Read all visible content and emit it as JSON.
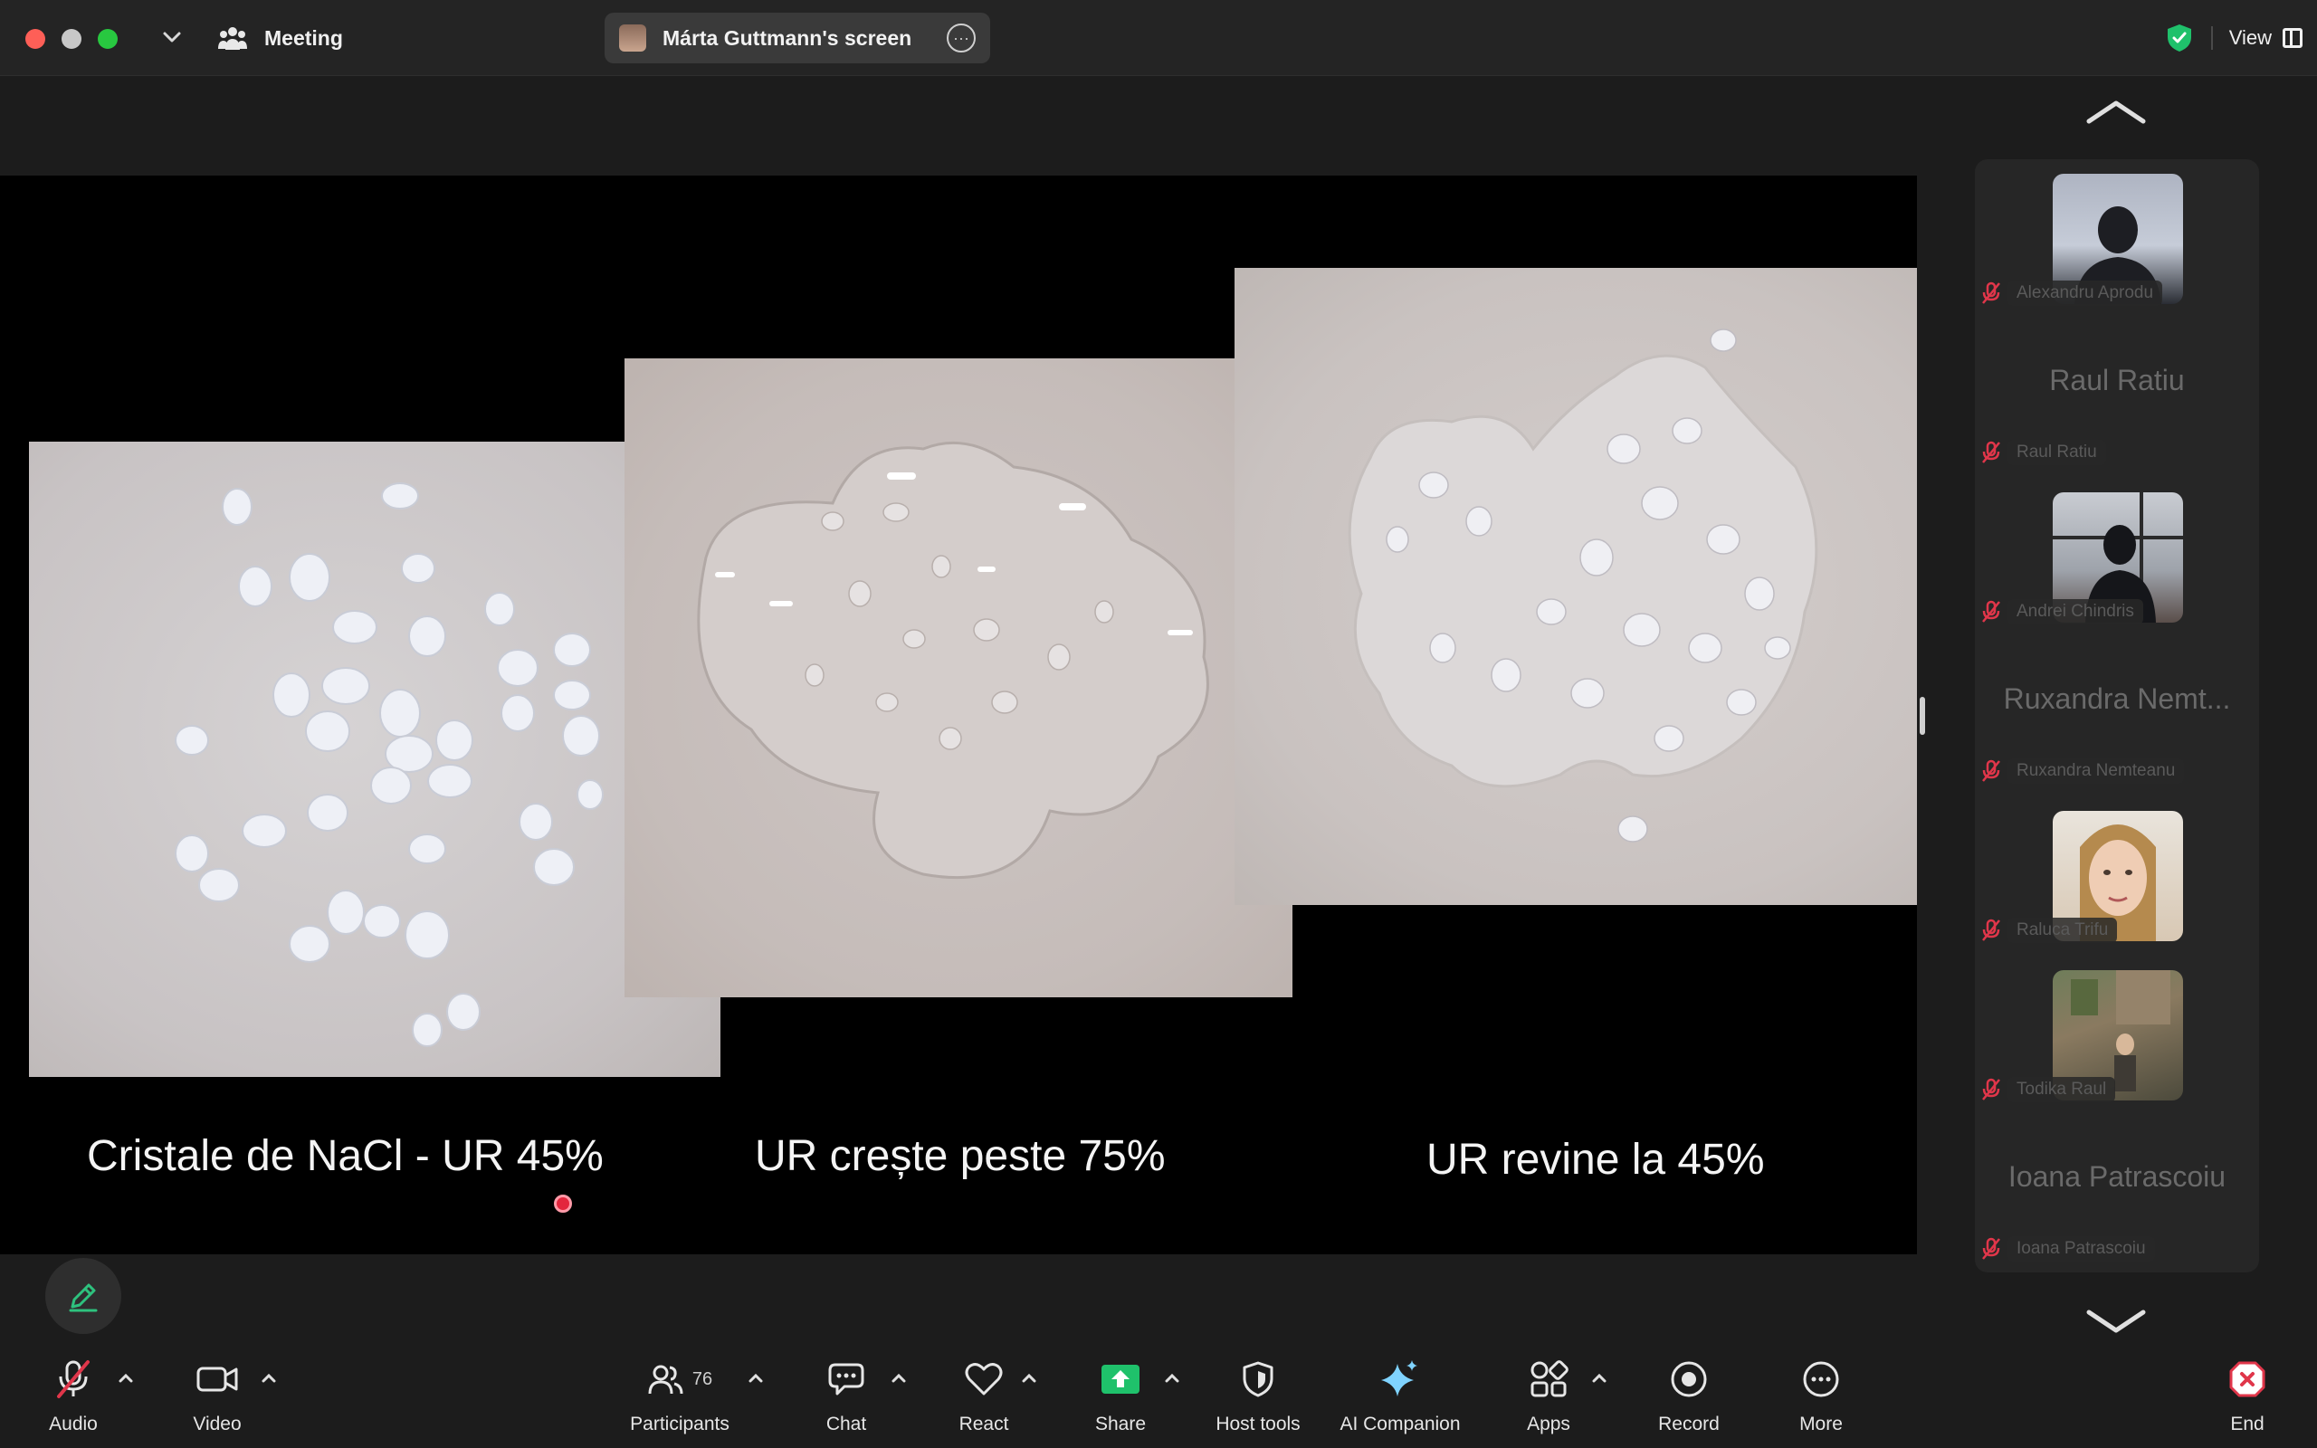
{
  "titlebar": {
    "meeting_label": "Meeting",
    "screen_share_label": "Márta Guttmann's screen",
    "view_label": "View"
  },
  "shared_screen": {
    "captions": [
      "Cristale de NaCl - UR 45%",
      "UR crește peste 75%",
      "UR revine la 45%"
    ]
  },
  "gallery": {
    "participants": [
      {
        "name": "Alexandru Aprodu",
        "video": true,
        "muted": true
      },
      {
        "name": "Raul Ratiu",
        "video": false,
        "muted": true
      },
      {
        "name": "Andrei Chindris",
        "video": true,
        "muted": true
      },
      {
        "name": "Ruxandra Nemteanu",
        "display_name": "Ruxandra Nemt...",
        "video": false,
        "muted": true
      },
      {
        "name": "Raluca Trifu",
        "video": true,
        "muted": true
      },
      {
        "name": "Todika Raul",
        "video": true,
        "muted": true
      },
      {
        "name": "Ioana Patrascoiu",
        "video": false,
        "muted": true
      }
    ]
  },
  "toolbar": {
    "audio": "Audio",
    "video": "Video",
    "participants": "Participants",
    "participants_count": "76",
    "chat": "Chat",
    "react": "React",
    "share": "Share",
    "host_tools": "Host tools",
    "ai_companion": "AI Companion",
    "apps": "Apps",
    "record": "Record",
    "more": "More",
    "end": "End"
  },
  "colors": {
    "share_green": "#1fc16b",
    "mute_red": "#e0364a",
    "end_red": "#e0364a",
    "ai_blue": "#7fd3ff"
  }
}
